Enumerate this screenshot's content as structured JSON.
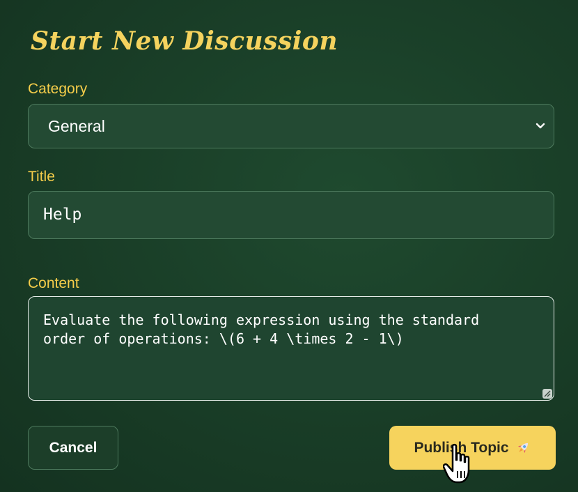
{
  "form": {
    "heading": "Start New Discussion",
    "category": {
      "label": "Category",
      "selected": "General"
    },
    "title_field": {
      "label": "Title",
      "value": "Help"
    },
    "content_field": {
      "label": "Content",
      "value": "Evaluate the following expression using the standard order of operations: \\(6 + 4 \\times 2 - 1\\)"
    },
    "buttons": {
      "cancel": "Cancel",
      "publish": "Publish Topic"
    }
  },
  "colors": {
    "background": "#1a3f28",
    "accent": "#f5cd4a",
    "button_primary": "#f6d35d"
  },
  "icons": {
    "select_chevron": "chevron-down-icon",
    "publish_icon": "rocket-icon",
    "cursor": "hand-pointer-cursor"
  }
}
